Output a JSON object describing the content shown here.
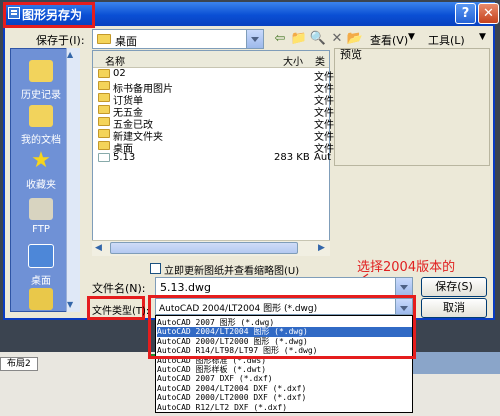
{
  "dialog": {
    "title": "图形另存为",
    "help_label": "?",
    "close_label": "✕"
  },
  "save_in": {
    "label": "保存于(I):",
    "value": "桌面"
  },
  "toolbar": {
    "views_label": "查看(V)",
    "tools_label": "工具(L)"
  },
  "preview": {
    "label": "预览"
  },
  "places": [
    {
      "label": "历史记录",
      "icon": "history-folder-icon"
    },
    {
      "label": "我的文档",
      "icon": "my-documents-icon"
    },
    {
      "label": "收藏夹",
      "icon": "favorites-star-icon"
    },
    {
      "label": "FTP",
      "icon": "ftp-icon"
    },
    {
      "label": "桌面",
      "icon": "desktop-icon"
    },
    {
      "label": "",
      "icon": "buzzsaw-icon"
    }
  ],
  "filelist": {
    "columns": {
      "name": "名称",
      "size": "大小",
      "type": "类"
    },
    "rows": [
      {
        "name": "02",
        "size": "",
        "type": "文件"
      },
      {
        "name": "标书备用图片",
        "size": "",
        "type": "文件"
      },
      {
        "name": "订货单",
        "size": "",
        "type": "文件"
      },
      {
        "name": "无五金",
        "size": "",
        "type": "文件"
      },
      {
        "name": "五金已改",
        "size": "",
        "type": "文件"
      },
      {
        "name": "新建文件夹",
        "size": "",
        "type": "文件"
      },
      {
        "name": "桌面",
        "size": "",
        "type": "文件"
      },
      {
        "name": "5.13",
        "size": "283 KB",
        "type": "Aut"
      }
    ]
  },
  "update_thumbnail": {
    "label": "立即更新图纸并查看缩略图(U)"
  },
  "filename": {
    "label": "文件名(N):",
    "value": "5.13.dwg"
  },
  "filetype": {
    "label": "文件类型(T):",
    "value": "AutoCAD 2004/LT2004 图形 (*.dwg)"
  },
  "buttons": {
    "save": "保存(S)",
    "cancel": "取消"
  },
  "dropdown": {
    "items": [
      "AutoCAD 2007 图形 (*.dwg)",
      "AutoCAD 2004/LT2004 图形 (*.dwg)",
      "AutoCAD 2000/LT2000 图形 (*.dwg)",
      "AutoCAD R14/LT98/LT97 图形 (*.dwg)",
      "AutoCAD 图形标准 (*.dws)",
      "AutoCAD 图形样板 (*.dwt)",
      "AutoCAD 2007 DXF (*.dxf)",
      "AutoCAD 2004/LT2004 DXF (*.dxf)",
      "AutoCAD 2000/LT2000 DXF (*.dxf)",
      "AutoCAD R12/LT2 DXF (*.dxf)"
    ],
    "selected_index": 1
  },
  "annotation": "选择2004版本的",
  "cad": {
    "layout_tab": "布局2"
  },
  "colors": {
    "accent": "#0a4fd4",
    "highlight": "#e51d1d",
    "selection": "#316ac5"
  }
}
